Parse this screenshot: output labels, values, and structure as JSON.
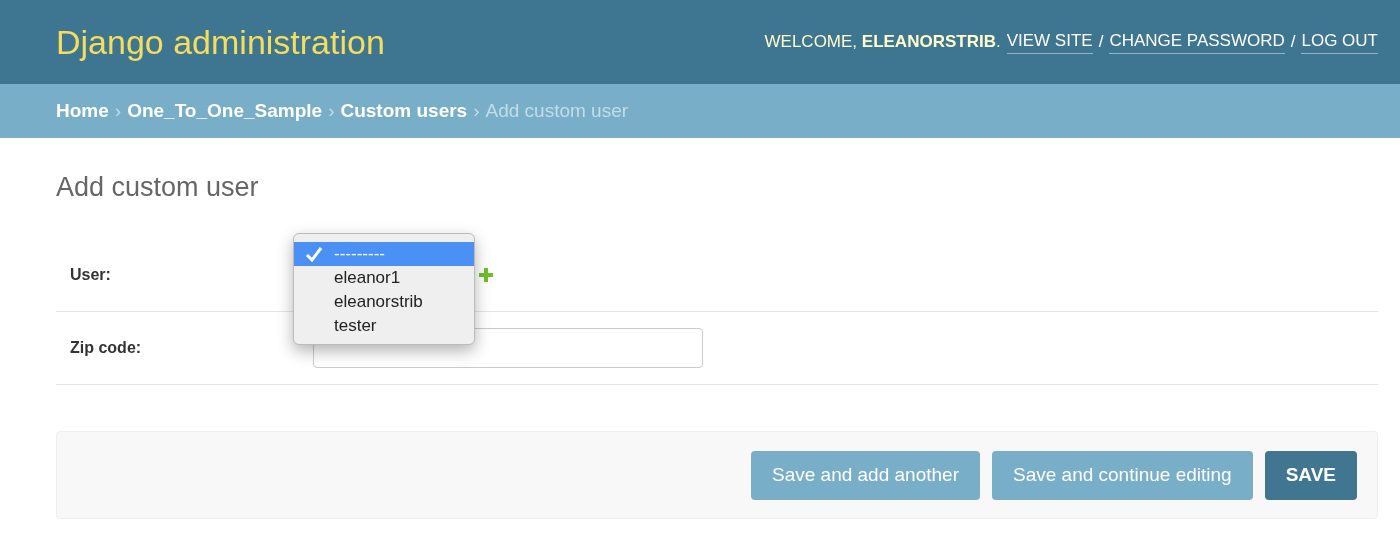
{
  "header": {
    "title": "Django administration",
    "welcome": "WELCOME, **ELEANORSTRIB**.",
    "links": [
      "VIEW SITE",
      "CHANGE PASSWORD",
      "LOG OUT"
    ],
    "separator": "/"
  },
  "breadcrumbs": {
    "separator": "›",
    "items": [
      {
        "label": "Home",
        "current": false
      },
      {
        "label": "One_To_One_Sample",
        "current": false
      },
      {
        "label": "Custom users",
        "current": false
      },
      {
        "label": "Add custom user",
        "current": true
      }
    ]
  },
  "page_title": "Add custom user",
  "fields": [
    {
      "kind": "select",
      "label": "User:",
      "expanded": true,
      "options": [
        {
          "label": "---------",
          "selected": true
        },
        {
          "label": "eleanor1",
          "selected": false
        },
        {
          "label": "eleanorstrib",
          "selected": false
        },
        {
          "label": "tester",
          "selected": false
        }
      ]
    },
    {
      "kind": "text",
      "label": "Zip code:"
    }
  ],
  "buttons": [
    {
      "label": "Save and add another",
      "kind": "secondary"
    },
    {
      "label": "Save and continue editing",
      "kind": "secondary"
    },
    {
      "label": "SAVE",
      "kind": "primary"
    }
  ]
}
